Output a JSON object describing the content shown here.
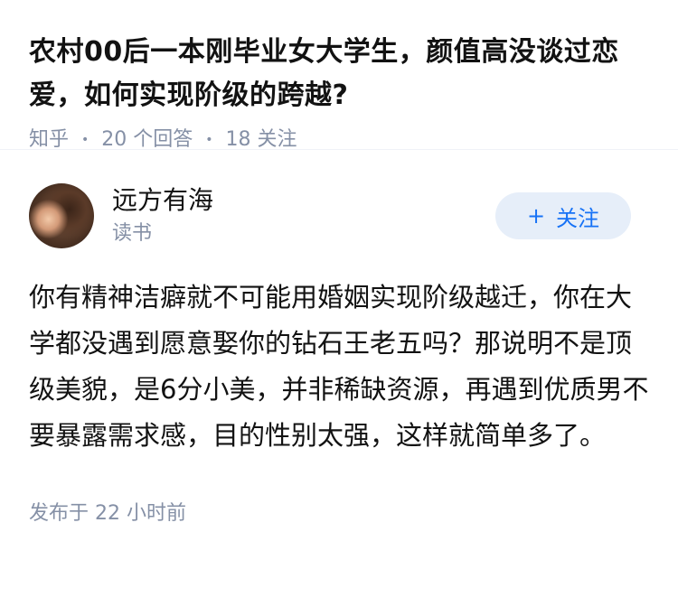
{
  "question": {
    "title": "农村00后一本刚毕业女大学生，颜值高没谈过恋爱，如何实现阶级的跨越?",
    "source": "知乎",
    "answers_count": "20 个回答",
    "followers_count": "18 关注"
  },
  "answer": {
    "author_name": "远方有海",
    "author_tag": "读书",
    "follow_button": {
      "icon": "+",
      "label": "关注"
    },
    "content": "你有精神洁癖就不可能用婚姻实现阶级越迁，你在大学都没遇到愿意娶你的钻石王老五吗？那说明不是顶级美貌，是6分小美，并非稀缺资源，再遇到优质男不要暴露需求感，目的性别太强，这样就简单多了。",
    "published": "发布于 22 小时前"
  },
  "colors": {
    "text": "#121212",
    "muted": "#8590a6",
    "accent": "#1772f6",
    "button_bg": "#e6eef9"
  }
}
